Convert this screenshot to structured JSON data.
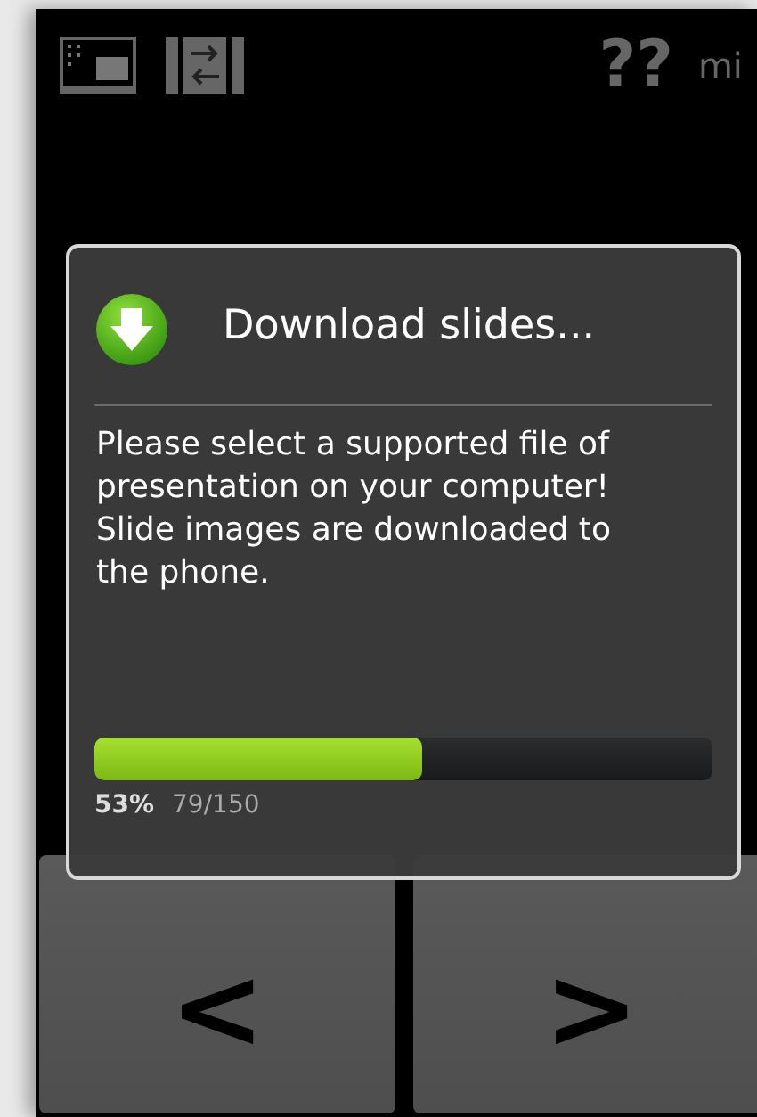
{
  "top_bar": {
    "time_value": "??",
    "time_unit": "mi"
  },
  "dialog": {
    "title": "Download slides...",
    "message": "Please select a supported file of presentation on your computer!\nSlide images are downloaded to the phone.",
    "progress": {
      "level": 0.53,
      "percent": "53%",
      "count": "79/150"
    }
  },
  "nav_buttons": [
    {
      "label": "<"
    },
    {
      "label": ">"
    }
  ]
}
